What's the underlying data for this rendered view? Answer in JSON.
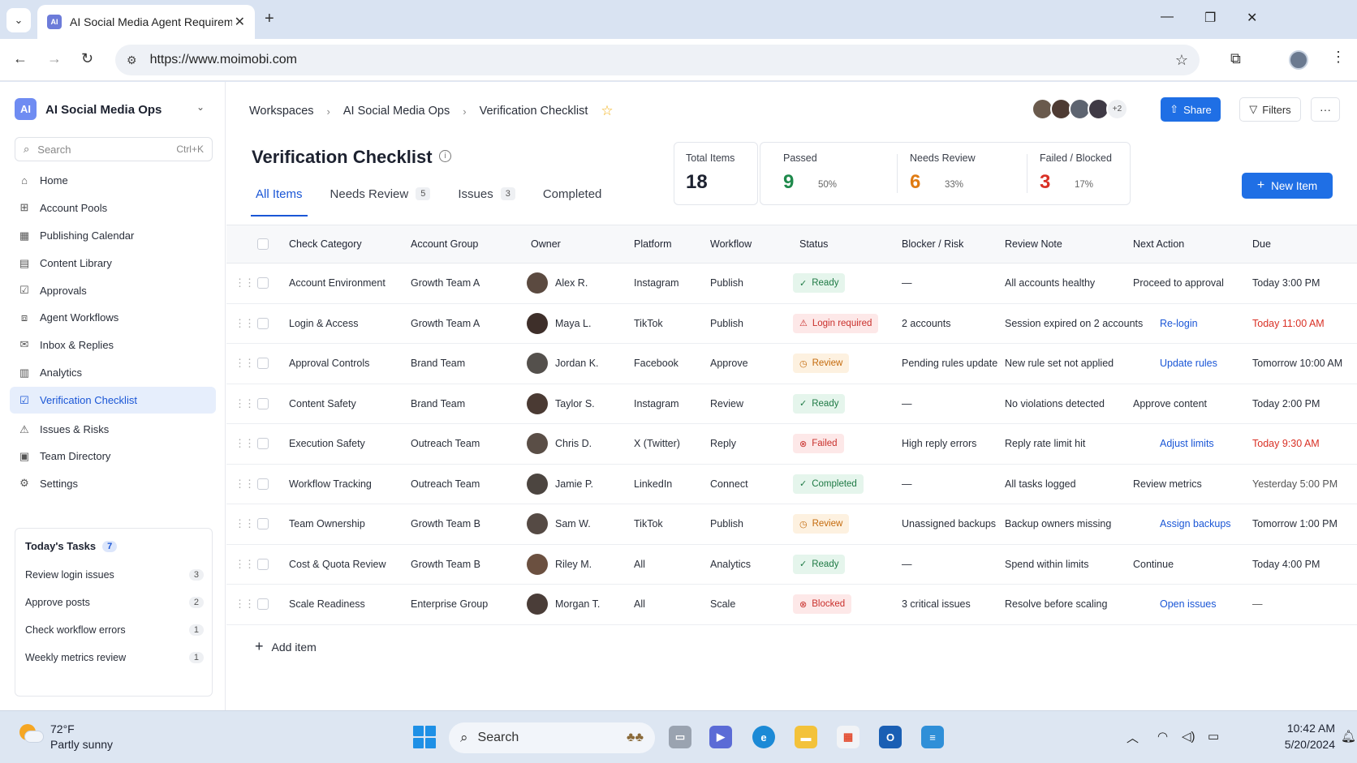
{
  "browser": {
    "tab_title": "AI Social Media Agent Requirem",
    "tab_favicon": "AI",
    "url": "https://www.moimobi.com"
  },
  "workspace": {
    "logo": "AI",
    "name": "AI Social Media Ops"
  },
  "sidebar": {
    "search_placeholder": "Search",
    "search_shortcut": "Ctrl+K",
    "items": [
      {
        "label": "Home",
        "icon": "home-icon"
      },
      {
        "label": "Account Pools",
        "icon": "account-pools-icon"
      },
      {
        "label": "Publishing Calendar",
        "icon": "calendar-icon"
      },
      {
        "label": "Content Library",
        "icon": "content-library-icon"
      },
      {
        "label": "Approvals",
        "icon": "approvals-icon"
      },
      {
        "label": "Agent Workflows",
        "icon": "workflow-icon"
      },
      {
        "label": "Inbox & Replies",
        "icon": "inbox-icon"
      },
      {
        "label": "Analytics",
        "icon": "analytics-icon"
      },
      {
        "label": "Verification Checklist",
        "icon": "checklist-icon",
        "active": true
      },
      {
        "label": "Issues & Risks",
        "icon": "warning-icon"
      },
      {
        "label": "Team Directory",
        "icon": "directory-icon"
      },
      {
        "label": "Settings",
        "icon": "gear-icon"
      }
    ],
    "tasks": {
      "title": "Today's Tasks",
      "count": "7",
      "items": [
        {
          "label": "Review login issues",
          "count": "3"
        },
        {
          "label": "Approve posts",
          "count": "2"
        },
        {
          "label": "Check workflow errors",
          "count": "1"
        },
        {
          "label": "Weekly metrics review",
          "count": "1"
        }
      ]
    }
  },
  "header": {
    "breadcrumbs": [
      "Workspaces",
      "AI Social Media Ops",
      "Verification Checklist"
    ],
    "more_avatars": "+2",
    "share_label": "Share",
    "filters_label": "Filters",
    "more_label": "···"
  },
  "page": {
    "title": "Verification Checklist",
    "tabs": [
      {
        "label": "All Items",
        "badge": ""
      },
      {
        "label": "Needs Review",
        "badge": "5"
      },
      {
        "label": "Issues",
        "badge": "3"
      },
      {
        "label": "Completed",
        "badge": ""
      }
    ],
    "stats": {
      "total": {
        "label": "Total Items",
        "value": "18"
      },
      "passed": {
        "label": "Passed",
        "value": "9",
        "pct": "50%",
        "color": "#1f8a4c"
      },
      "review": {
        "label": "Needs Review",
        "value": "6",
        "pct": "33%",
        "color": "#e07b12"
      },
      "failed": {
        "label": "Failed / Blocked",
        "value": "3",
        "pct": "17%",
        "color": "#d93025"
      }
    },
    "new_item_label": "New Item",
    "add_item_label": "Add item"
  },
  "table": {
    "columns": [
      "Check Category",
      "Account Group",
      "Owner",
      "Platform",
      "Workflow",
      "Status",
      "Blocker / Risk",
      "Review Note",
      "Next Action",
      "Due"
    ],
    "rows": [
      {
        "category": "Account Environment",
        "group": "Growth Team A",
        "owner": "Alex R.",
        "platform": "Instagram",
        "workflow": "Publish",
        "status": "Ready",
        "status_kind": "ready",
        "blocker": "—",
        "note": "All accounts healthy",
        "action": "Proceed to approval",
        "action_link": false,
        "due": "Today 3:00 PM",
        "due_kind": "normal"
      },
      {
        "category": "Login & Access",
        "group": "Growth Team A",
        "owner": "Maya L.",
        "platform": "TikTok",
        "workflow": "Publish",
        "status": "Login required",
        "status_kind": "failed",
        "blocker": "2 accounts",
        "note": "Session expired on 2 accounts",
        "action": "Re-login",
        "action_link": true,
        "due": "Today 11:00 AM",
        "due_kind": "red"
      },
      {
        "category": "Approval Controls",
        "group": "Brand Team",
        "owner": "Jordan K.",
        "platform": "Facebook",
        "workflow": "Approve",
        "status": "Review",
        "status_kind": "review",
        "blocker": "Pending rules update",
        "note": "New rule set not applied",
        "action": "Update rules",
        "action_link": true,
        "due": "Tomorrow 10:00 AM",
        "due_kind": "normal"
      },
      {
        "category": "Content Safety",
        "group": "Brand Team",
        "owner": "Taylor S.",
        "platform": "Instagram",
        "workflow": "Review",
        "status": "Ready",
        "status_kind": "ready",
        "blocker": "—",
        "note": "No violations detected",
        "action": "Approve content",
        "action_link": false,
        "due": "Today 2:00 PM",
        "due_kind": "normal"
      },
      {
        "category": "Execution Safety",
        "group": "Outreach Team",
        "owner": "Chris D.",
        "platform": "X (Twitter)",
        "workflow": "Reply",
        "status": "Failed",
        "status_kind": "failed",
        "blocker": "High reply errors",
        "note": "Reply rate limit hit",
        "action": "Adjust limits",
        "action_link": true,
        "due": "Today 9:30 AM",
        "due_kind": "red"
      },
      {
        "category": "Workflow Tracking",
        "group": "Outreach Team",
        "owner": "Jamie P.",
        "platform": "LinkedIn",
        "workflow": "Connect",
        "status": "Completed",
        "status_kind": "completed",
        "blocker": "—",
        "note": "All tasks logged",
        "action": "Review metrics",
        "action_link": false,
        "due": "Yesterday 5:00 PM",
        "due_kind": "grey"
      },
      {
        "category": "Team Ownership",
        "group": "Growth Team B",
        "owner": "Sam W.",
        "platform": "TikTok",
        "workflow": "Publish",
        "status": "Review",
        "status_kind": "review",
        "blocker": "Unassigned backups",
        "note": "Backup owners missing",
        "action": "Assign backups",
        "action_link": true,
        "due": "Tomorrow 1:00 PM",
        "due_kind": "normal"
      },
      {
        "category": "Cost & Quota Review",
        "group": "Growth Team B",
        "owner": "Riley M.",
        "platform": "All",
        "workflow": "Analytics",
        "status": "Ready",
        "status_kind": "ready",
        "blocker": "—",
        "note": "Spend within limits",
        "action": "Continue",
        "action_link": false,
        "due": "Today 4:00 PM",
        "due_kind": "normal"
      },
      {
        "category": "Scale Readiness",
        "group": "Enterprise Group",
        "owner": "Morgan T.",
        "platform": "All",
        "workflow": "Scale",
        "status": "Blocked",
        "status_kind": "failed",
        "blocker": "3 critical issues",
        "note": "Resolve before scaling",
        "action": "Open issues",
        "action_link": true,
        "due": "—",
        "due_kind": "grey"
      }
    ]
  },
  "taskbar": {
    "weather_temp": "72°F",
    "weather_desc": "Partly sunny",
    "search_placeholder": "Search",
    "time": "10:42 AM",
    "date": "5/20/2024"
  }
}
